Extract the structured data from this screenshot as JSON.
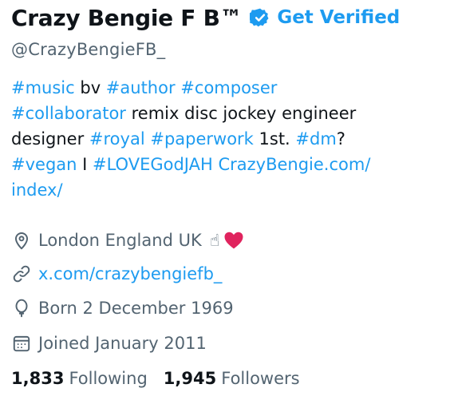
{
  "profile": {
    "display_name": "Crazy Bengie F B™",
    "get_verified_label": "Get Verified",
    "handle": "@CrazyBengieFB_"
  },
  "bio": {
    "line1": {
      "t1": "#music",
      "t2": " bv ",
      "t3": "#author",
      "t4": " ",
      "t5": "#composer"
    },
    "line2": {
      "t1": "#collaborator",
      "t2": " remix disc jockey engineer"
    },
    "line3": {
      "t1": "designer ",
      "t2": "#royal",
      "t3": " ",
      "t4": "#paperwork",
      "t5": " 1st. ",
      "t6": "#dm",
      "t7": "?"
    },
    "line4": {
      "t1": "#vegan",
      "t2": " I ",
      "t3": "#LOVEGodJAH",
      "t4": " ",
      "t5": "CrazyBengie.com/"
    },
    "line5": {
      "t1": "index/"
    }
  },
  "meta": {
    "location": "London England UK",
    "location_emoji_hand": "☝",
    "icons": {
      "location": "location-pin-icon",
      "link": "link-icon",
      "birthday": "balloon-icon",
      "joined": "calendar-icon",
      "verified": "verified-badge-icon",
      "heart": "red-heart-icon"
    },
    "website": "x.com/crazybengiefb_",
    "born": "Born 2 December 1969",
    "joined": "Joined January 2011"
  },
  "stats": {
    "following_count": "1,833",
    "following_label": "Following",
    "followers_count": "1,945",
    "followers_label": "Followers"
  },
  "colors": {
    "accent": "#1d9bf0",
    "text": "#0f1419",
    "secondary": "#536471",
    "heart": "#e0245e"
  }
}
